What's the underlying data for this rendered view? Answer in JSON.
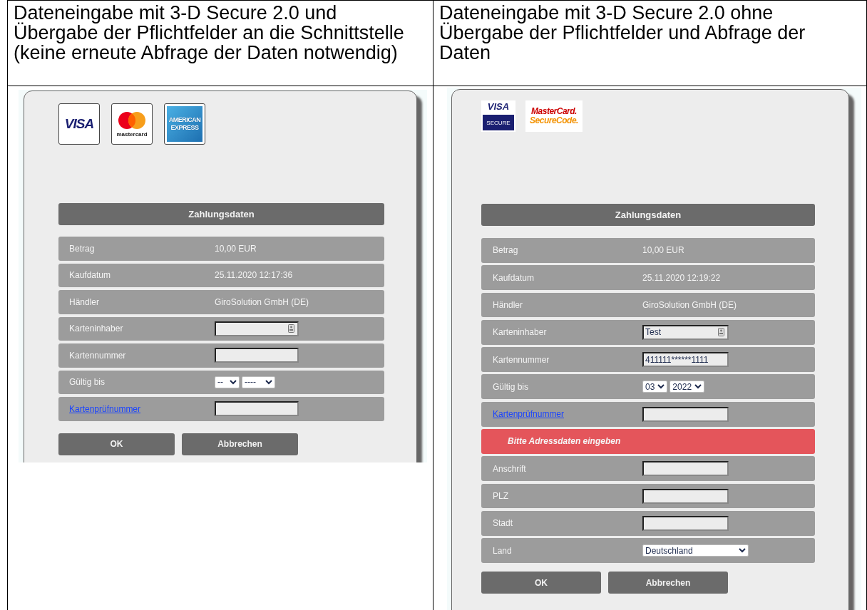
{
  "table": {
    "columns": [
      {
        "header": "Dateneingabe mit 3-D Secure 2.0 und\nÜbergabe der Pflichtfelder an die Schnittstelle\n(keine erneute Abfrage der Daten notwendig)"
      },
      {
        "header": "Dateneingabe mit 3-D Secure 2.0 ohne\nÜbergabe der Pflichtfelder und Abfrage der\nDaten"
      }
    ]
  },
  "screenshots": [
    {
      "logos": [
        {
          "kind": "visa",
          "lines": [
            "VISA"
          ]
        },
        {
          "kind": "mastercard",
          "lines": [
            "mastercard"
          ]
        },
        {
          "kind": "amex",
          "lines": [
            "AMERICAN",
            "EXPRESS"
          ]
        }
      ],
      "title": "Zahlungsdaten",
      "rows": [
        {
          "kind": "info",
          "label": "Betrag",
          "value": "10,00 EUR"
        },
        {
          "kind": "info",
          "label": "Kaufdatum",
          "value": "25.11.2020 12:17:36"
        },
        {
          "kind": "info",
          "label": "Händler",
          "value": "GiroSolution GmbH (DE)"
        },
        {
          "kind": "input",
          "label": "Karteninhaber",
          "autofill": true
        },
        {
          "kind": "input",
          "label": "Kartennummer"
        },
        {
          "kind": "expiry",
          "label": "Gültig bis",
          "month": "--",
          "year": "----"
        },
        {
          "kind": "input",
          "label": "Kartenprüfnummer",
          "label_link": true
        }
      ],
      "buttons": [
        "OK",
        "Abbrechen"
      ]
    },
    {
      "logos": [
        {
          "kind": "visa-secure",
          "lines": [
            "VISA",
            "SECURE"
          ]
        },
        {
          "kind": "securecode",
          "lines": [
            "MasterCard.",
            "SecureCode."
          ]
        }
      ],
      "title": "Zahlungsdaten",
      "rows": [
        {
          "kind": "info",
          "label": "Betrag",
          "value": "10,00 EUR"
        },
        {
          "kind": "info",
          "label": "Kaufdatum",
          "value": "25.11.2020 12:19:22"
        },
        {
          "kind": "info",
          "label": "Händler",
          "value": "GiroSolution GmbH (DE)"
        },
        {
          "kind": "input",
          "label": "Karteninhaber",
          "value": "Test",
          "autofill": true
        },
        {
          "kind": "input",
          "label": "Kartennummer",
          "value": "411111******1111"
        },
        {
          "kind": "expiry",
          "label": "Gültig bis",
          "month": "03",
          "year": "2022"
        },
        {
          "kind": "input",
          "label": "Kartenprüfnummer",
          "label_link": true
        },
        {
          "kind": "notice",
          "text": "Bitte Adressdaten eingeben"
        },
        {
          "kind": "input",
          "label": "Anschrift"
        },
        {
          "kind": "input",
          "label": "PLZ"
        },
        {
          "kind": "input",
          "label": "Stadt"
        },
        {
          "kind": "select",
          "label": "Land",
          "value": "Deutschland"
        }
      ],
      "buttons": [
        "OK",
        "Abbrechen"
      ]
    }
  ]
}
